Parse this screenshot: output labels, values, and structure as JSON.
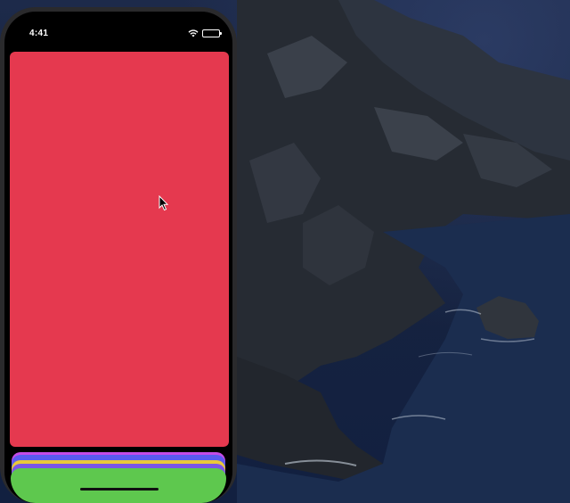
{
  "status_bar": {
    "time": "4:41",
    "wifi_icon": "wifi-icon",
    "battery_icon": "battery-icon",
    "battery_level": 1.0
  },
  "cards": {
    "front_card_color": "#e5394f",
    "stacked_card_colors": [
      "#c44be8",
      "#5a5af0",
      "#e9c93a",
      "#7a55e6",
      "#5ec84e"
    ]
  },
  "cursor_icon": "mouse-pointer-icon",
  "colors": {
    "phone_bezel": "#2a2a2c",
    "screen_background": "#000000",
    "wallpaper_sky": "#1d2a4a"
  }
}
